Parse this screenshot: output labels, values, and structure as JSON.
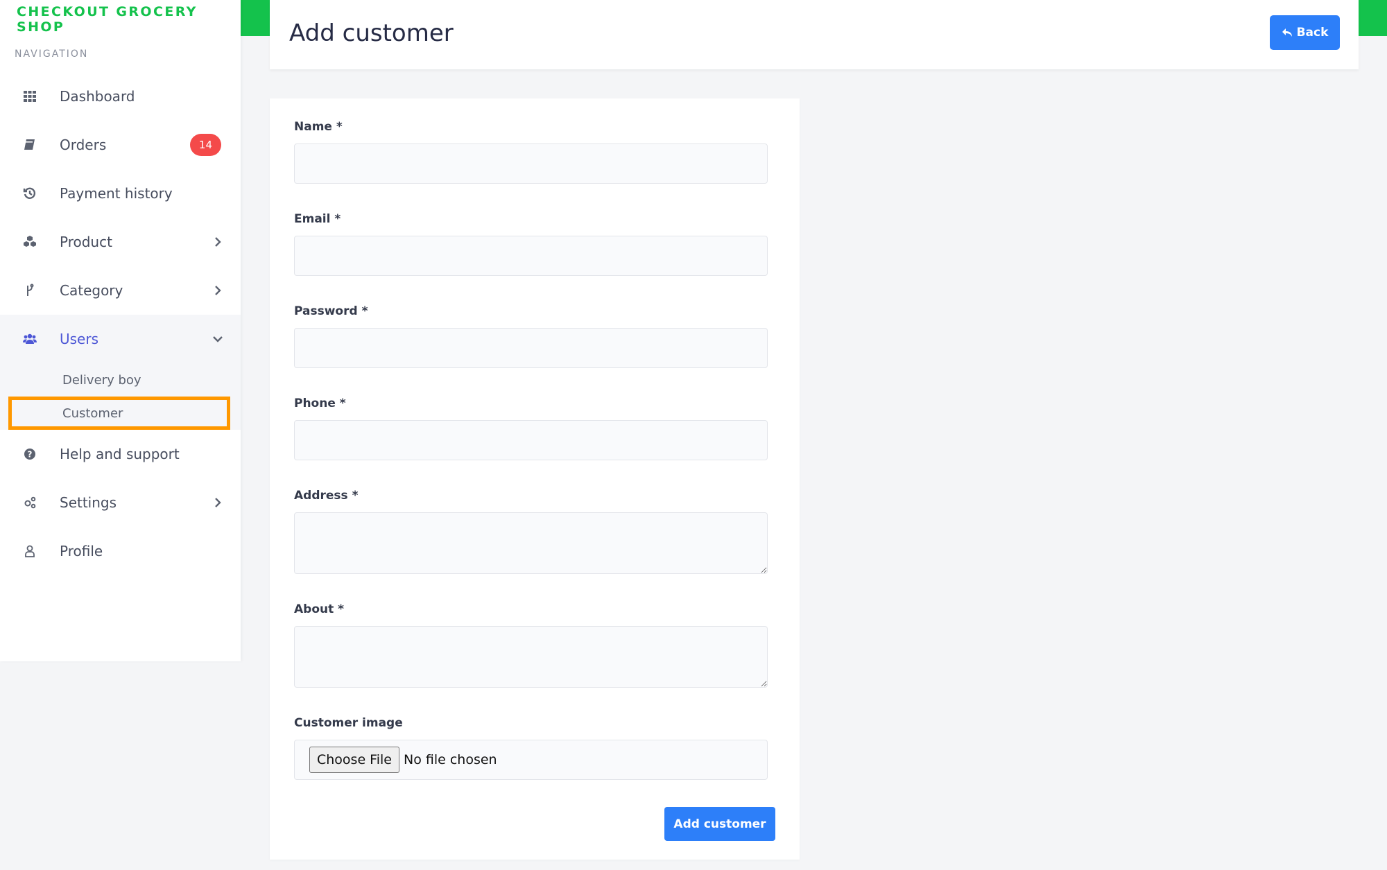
{
  "app": {
    "brand": "CHECKOUT GROCERY SHOP",
    "accent_color": "#14c24c",
    "primary_color": "#2d7ff9"
  },
  "sidebar": {
    "caption": "NAVIGATION",
    "items": [
      {
        "label": "Dashboard",
        "icon": "grid-icon"
      },
      {
        "label": "Orders",
        "icon": "book-icon",
        "badge": "14"
      },
      {
        "label": "Payment history",
        "icon": "history-icon"
      },
      {
        "label": "Product",
        "icon": "cubes-icon",
        "expandable": true
      },
      {
        "label": "Category",
        "icon": "branch-icon",
        "expandable": true
      },
      {
        "label": "Users",
        "icon": "users-icon",
        "expanded": true,
        "children": [
          {
            "label": "Delivery boy"
          },
          {
            "label": "Customer",
            "highlighted": true
          }
        ]
      },
      {
        "label": "Help and support",
        "icon": "question-circle-icon"
      },
      {
        "label": "Settings",
        "icon": "gears-icon",
        "expandable": true
      },
      {
        "label": "Profile",
        "icon": "user-outline-icon"
      }
    ]
  },
  "header": {
    "title": "Add customer",
    "back_label": "Back"
  },
  "form": {
    "fields": [
      {
        "label": "Name *",
        "value": "",
        "type": "text"
      },
      {
        "label": "Email *",
        "value": "",
        "type": "text"
      },
      {
        "label": "Password *",
        "value": "",
        "type": "password"
      },
      {
        "label": "Phone *",
        "value": "",
        "type": "text"
      },
      {
        "label": "Address *",
        "value": "",
        "type": "textarea"
      },
      {
        "label": "About *",
        "value": "",
        "type": "textarea"
      }
    ],
    "image": {
      "label": "Customer image",
      "button_label": "Choose File",
      "status": "No file chosen"
    },
    "submit_label": "Add customer"
  }
}
